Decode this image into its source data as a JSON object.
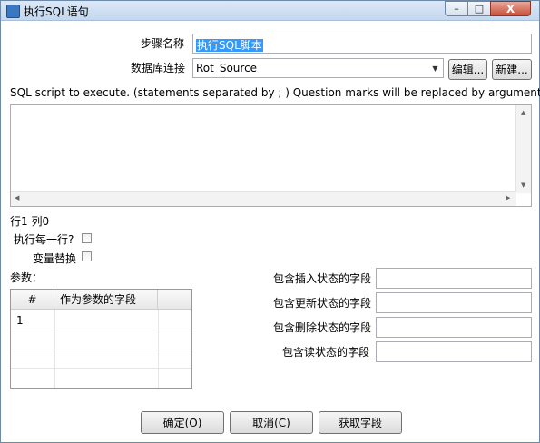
{
  "window": {
    "title": "执行SQL语句",
    "min": "–",
    "max": "□",
    "close": "X"
  },
  "form": {
    "step_name_label": "步骤名称",
    "step_name_value": "执行SQL脚本",
    "db_conn_label": "数据库连接",
    "db_conn_value": "Rot_Source",
    "edit_button": "编辑...",
    "new_button": "新建...",
    "sql_hint": "SQL script to execute. (statements separated by ; ) Question marks will be replaced by arguments.",
    "sql_text": "",
    "cursor_pos": "行1 列0",
    "execute_each_row_label": "执行每一行?",
    "variable_sub_label": "变量替换",
    "params_label": "参数："
  },
  "params_table": {
    "columns": [
      "#",
      "作为参数的字段"
    ],
    "rows": [
      {
        "num": "1",
        "field": ""
      }
    ]
  },
  "status_fields": {
    "insert_label": "包含插入状态的字段",
    "update_label": "包含更新状态的字段",
    "delete_label": "包含删除状态的字段",
    "read_label": "包含读状态的字段"
  },
  "footer": {
    "ok": "确定(O)",
    "cancel": "取消(C)",
    "get_fields": "获取字段"
  }
}
